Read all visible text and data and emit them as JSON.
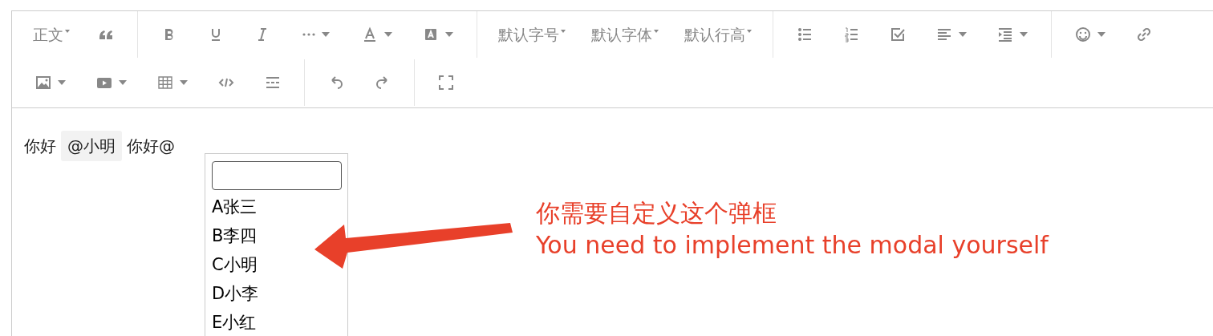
{
  "toolbar": {
    "rows": [
      [
        [
          {
            "kind": "text",
            "label": "正文",
            "dropdown": true
          },
          {
            "kind": "icon",
            "dropdown": false
          }
        ],
        [
          {
            "kind": "icon",
            "dropdown": false
          },
          {
            "kind": "icon",
            "dropdown": false
          },
          {
            "kind": "icon",
            "dropdown": false
          },
          {
            "kind": "icon",
            "dropdown": true
          },
          {
            "kind": "icon",
            "dropdown": true
          },
          {
            "kind": "icon",
            "dropdown": true
          }
        ],
        [
          {
            "kind": "text",
            "label": "默认字号",
            "dropdown": true
          },
          {
            "kind": "text",
            "label": "默认字体",
            "dropdown": true
          },
          {
            "kind": "text",
            "label": "默认行高",
            "dropdown": true
          }
        ],
        [
          {
            "kind": "icon",
            "dropdown": false
          },
          {
            "kind": "icon",
            "dropdown": false
          },
          {
            "kind": "icon",
            "dropdown": false
          },
          {
            "kind": "icon",
            "dropdown": true
          },
          {
            "kind": "icon",
            "dropdown": true
          }
        ],
        [
          {
            "kind": "icon",
            "dropdown": true
          },
          {
            "kind": "icon",
            "dropdown": false
          }
        ]
      ],
      [
        [
          {
            "kind": "icon",
            "dropdown": true
          },
          {
            "kind": "icon",
            "dropdown": true
          },
          {
            "kind": "icon",
            "dropdown": true
          },
          {
            "kind": "icon",
            "dropdown": false
          },
          {
            "kind": "icon",
            "dropdown": false
          }
        ],
        [
          {
            "kind": "icon",
            "dropdown": false
          },
          {
            "kind": "icon",
            "dropdown": false
          }
        ],
        [
          {
            "kind": "icon",
            "dropdown": false
          }
        ]
      ]
    ]
  },
  "content": [
    {
      "kind": "text",
      "text": "你好"
    },
    {
      "kind": "mention",
      "text": "@小明"
    },
    {
      "kind": "text",
      "text": "你好@"
    }
  ],
  "mention_popup": {
    "items": [
      "A张三",
      "B李四",
      "C小明",
      "D小李",
      "E小红"
    ]
  },
  "annotation": {
    "lines": [
      "你需要自定义这个弹框",
      "You need to implement the modal yourself"
    ]
  }
}
